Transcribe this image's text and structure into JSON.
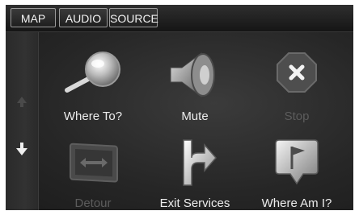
{
  "tabs": [
    "MAP",
    "AUDIO",
    "SOURCE"
  ],
  "menu": [
    {
      "label": "Where To?",
      "icon": "magnifier-icon",
      "enabled": true
    },
    {
      "label": "Mute",
      "icon": "speaker-icon",
      "enabled": true
    },
    {
      "label": "Stop",
      "icon": "stop-icon",
      "enabled": false
    },
    {
      "label": "Detour",
      "icon": "detour-icon",
      "enabled": false
    },
    {
      "label": "Exit Services",
      "icon": "exit-services-icon",
      "enabled": true
    },
    {
      "label": "Where Am I?",
      "icon": "where-am-i-icon",
      "enabled": true
    }
  ],
  "scroll": {
    "up_enabled": false,
    "down_enabled": true
  }
}
